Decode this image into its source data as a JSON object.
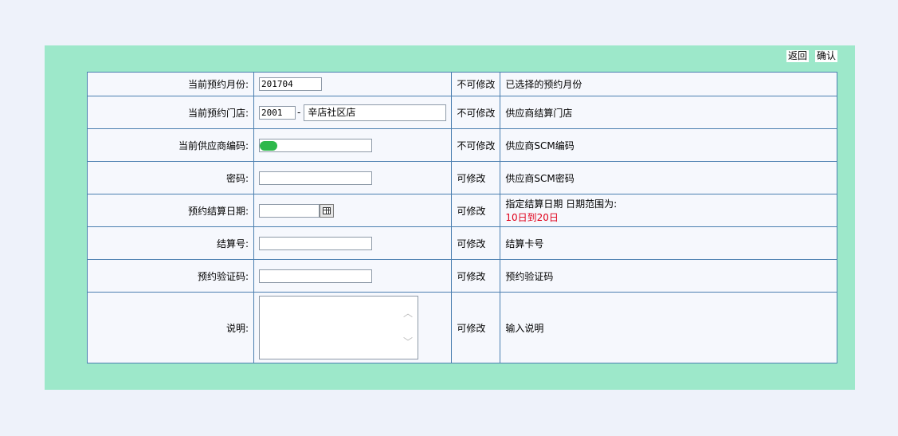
{
  "actions": {
    "back": "返回",
    "confirm": "确认"
  },
  "rows": [
    {
      "label": "当前预约月份:",
      "value": "201704",
      "mod": "不可修改",
      "desc": "已选择的预约月份"
    },
    {
      "label": "当前预约门店:",
      "store_code": "2001",
      "sep": "-",
      "store_name": "辛店社区店",
      "mod": "不可修改",
      "desc": "供应商结算门店"
    },
    {
      "label": "当前供应商编码:",
      "value": "",
      "mod": "不可修改",
      "desc": "供应商SCM编码"
    },
    {
      "label": "密码:",
      "value": "",
      "mod": "可修改",
      "desc": "供应商SCM密码"
    },
    {
      "label": "预约结算日期:",
      "value": "",
      "mod": "可修改",
      "desc": "指定结算日期 日期范围为:",
      "desc_range": "10日到20日"
    },
    {
      "label": "结算号:",
      "value": "",
      "mod": "可修改",
      "desc": "结算卡号"
    },
    {
      "label": "预约验证码:",
      "value": "",
      "mod": "可修改",
      "desc": "预约验证码"
    },
    {
      "label": "说明:",
      "value": "",
      "mod": "可修改",
      "desc": "输入说明"
    }
  ],
  "icons": {
    "calendar": "calendar-icon",
    "scroll_up": "chevron-up-icon",
    "scroll_down": "chevron-down-icon"
  },
  "colors": {
    "panel": "#9de8ca",
    "border": "#4b7fb0",
    "highlight": "#e0001a",
    "mask": "#2db84a"
  }
}
